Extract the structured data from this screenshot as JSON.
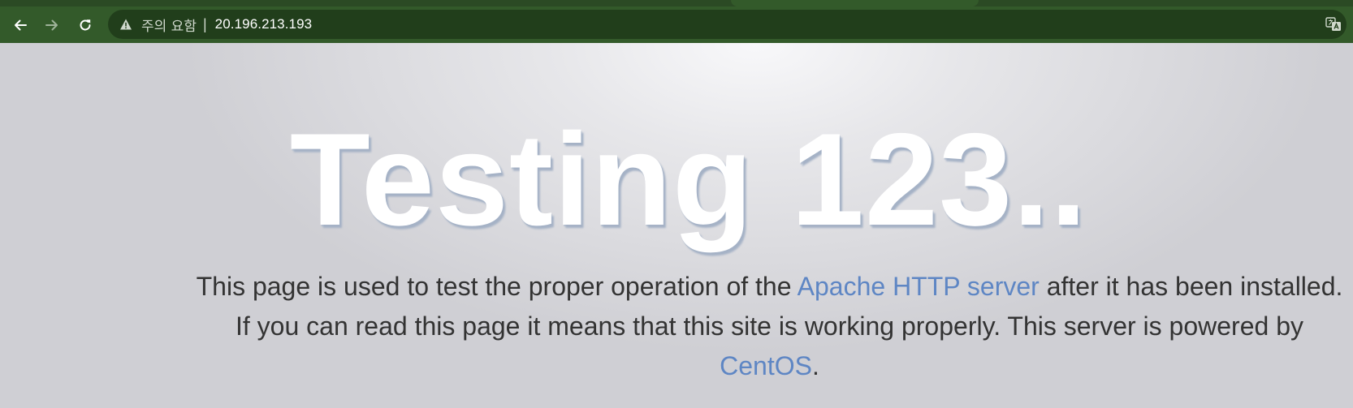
{
  "browser": {
    "security_label": "주의 요함",
    "divider": "|",
    "url": "20.196.213.193",
    "colors": {
      "chrome": "#335a2a",
      "omnibox": "#213e1b"
    },
    "icons": [
      "back-arrow-icon",
      "forward-arrow-icon",
      "reload-icon",
      "warning-triangle-icon",
      "translate-icon"
    ]
  },
  "page": {
    "headline": "Testing 123..",
    "paragraph": {
      "part1": "This page is used to test the proper operation of the ",
      "link1": "Apache HTTP server",
      "part2": " after it has been installed. If you can read this page it means that this site is working properly. This server is powered by ",
      "link2": "CentOS",
      "part3": "."
    },
    "colors": {
      "link": "#5e86c4",
      "text": "#333333",
      "headline": "#ffffff"
    }
  }
}
